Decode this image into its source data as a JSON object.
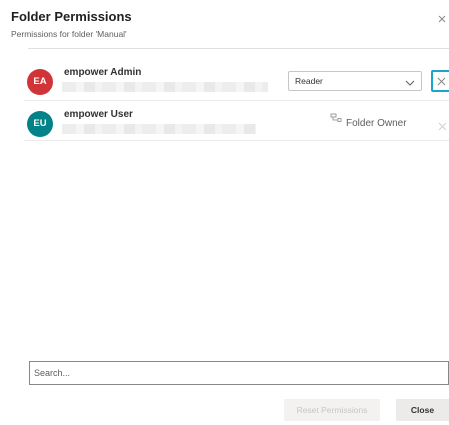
{
  "dialog": {
    "title": "Folder Permissions",
    "subtitle": "Permissions for folder 'Manual'",
    "close_icon": "close-icon"
  },
  "users": [
    {
      "initials": "EA",
      "name": "empower Admin",
      "avatar_color": "#d13438",
      "role": "Reader",
      "remove_icon": "close-icon",
      "remove_state": "focused"
    },
    {
      "initials": "EU",
      "name": "empower User",
      "avatar_color": "#038387",
      "role": "Folder Owner",
      "role_icon": "owner-icon",
      "remove_icon": "close-icon",
      "remove_state": "disabled"
    }
  ],
  "search": {
    "placeholder": "Search..."
  },
  "footer": {
    "reset_label": "Reset Permissions",
    "close_label": "Close"
  },
  "colors": {
    "focus_outline": "#1ba5cc",
    "border": "#c8c6c4",
    "divider": "#e1dfdd"
  }
}
